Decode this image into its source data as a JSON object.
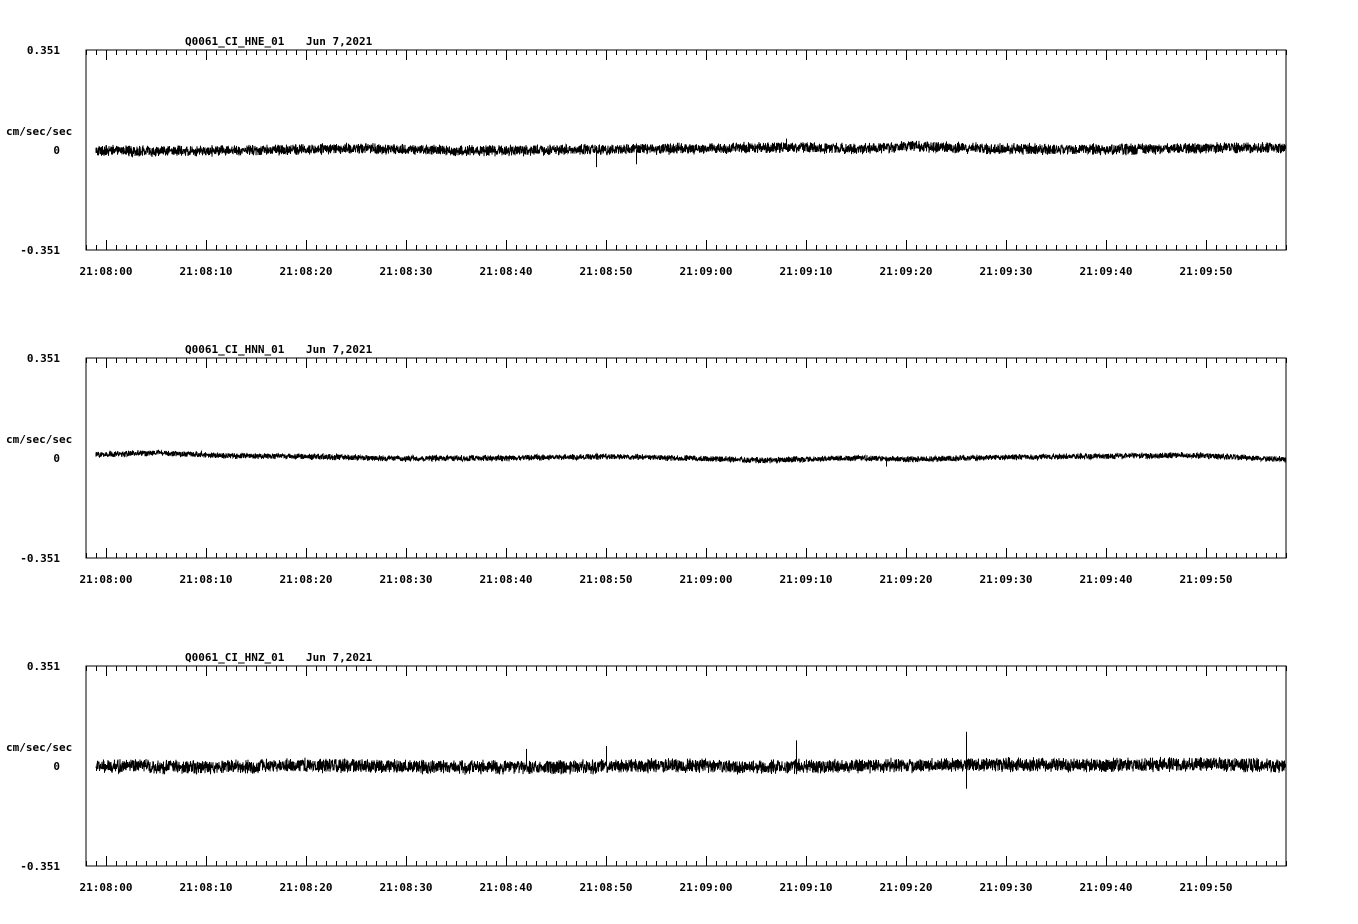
{
  "panels": [
    {
      "title": "Q0061_CI_HNE_01",
      "date": "Jun 7,2021",
      "ylabel": "cm/sec/sec",
      "ytick_labels": [
        "0.351",
        "0",
        "-0.351"
      ],
      "xtick_labels": [
        "21:08:00",
        "21:08:10",
        "21:08:20",
        "21:08:30",
        "21:08:40",
        "21:08:50",
        "21:09:00",
        "21:09:10",
        "21:09:20",
        "21:09:30",
        "21:09:40",
        "21:09:50"
      ]
    },
    {
      "title": "Q0061_CI_HNN_01",
      "date": "Jun 7,2021",
      "ylabel": "cm/sec/sec",
      "ytick_labels": [
        "0.351",
        "0",
        "-0.351"
      ],
      "xtick_labels": [
        "21:08:00",
        "21:08:10",
        "21:08:20",
        "21:08:30",
        "21:08:40",
        "21:08:50",
        "21:09:00",
        "21:09:10",
        "21:09:20",
        "21:09:30",
        "21:09:40",
        "21:09:50"
      ]
    },
    {
      "title": "Q0061_CI_HNZ_01",
      "date": "Jun 7,2021",
      "ylabel": "cm/sec/sec",
      "ytick_labels": [
        "0.351",
        "0",
        "-0.351"
      ],
      "xtick_labels": [
        "21:08:00",
        "21:08:10",
        "21:08:20",
        "21:08:30",
        "21:08:40",
        "21:08:50",
        "21:09:00",
        "21:09:10",
        "21:09:20",
        "21:09:30",
        "21:09:40",
        "21:09:50"
      ]
    }
  ],
  "chart_data": [
    {
      "type": "line",
      "title": "Q0061_CI_HNE_01  Jun 7,2021",
      "ylabel": "cm/sec/sec",
      "ylim": [
        -0.351,
        0.351
      ],
      "x_start": "21:07:58",
      "x_end": "21:09:58",
      "xtick_labels": [
        "21:08:00",
        "21:08:10",
        "21:08:20",
        "21:08:30",
        "21:08:40",
        "21:08:50",
        "21:09:00",
        "21:09:10",
        "21:09:20",
        "21:09:30",
        "21:09:40",
        "21:09:50"
      ],
      "noise_amplitude": 0.022,
      "drift": [
        [
          "21:07:58",
          0.0
        ],
        [
          "21:08:05",
          -0.005
        ],
        [
          "21:08:15",
          0.0
        ],
        [
          "21:08:26",
          0.006
        ],
        [
          "21:08:35",
          -0.003
        ],
        [
          "21:08:45",
          0.0
        ],
        [
          "21:08:50",
          0.002
        ],
        [
          "21:09:00",
          0.005
        ],
        [
          "21:09:08",
          0.01
        ],
        [
          "21:09:15",
          0.004
        ],
        [
          "21:09:20",
          0.012
        ],
        [
          "21:09:30",
          0.004
        ],
        [
          "21:09:40",
          0.002
        ],
        [
          "21:09:50",
          0.006
        ],
        [
          "21:09:58",
          0.008
        ]
      ],
      "spikes": [
        [
          "21:08:49",
          -0.06
        ],
        [
          "21:08:53",
          -0.05
        ],
        [
          "21:09:08",
          0.04
        ]
      ]
    },
    {
      "type": "line",
      "title": "Q0061_CI_HNN_01  Jun 7,2021",
      "ylabel": "cm/sec/sec",
      "ylim": [
        -0.351,
        0.351
      ],
      "x_start": "21:07:58",
      "x_end": "21:09:58",
      "xtick_labels": [
        "21:08:00",
        "21:08:10",
        "21:08:20",
        "21:08:30",
        "21:08:40",
        "21:08:50",
        "21:09:00",
        "21:09:10",
        "21:09:20",
        "21:09:30",
        "21:09:40",
        "21:09:50"
      ],
      "noise_amplitude": 0.012,
      "drift": [
        [
          "21:07:58",
          0.012
        ],
        [
          "21:08:05",
          0.018
        ],
        [
          "21:08:12",
          0.008
        ],
        [
          "21:08:20",
          0.005
        ],
        [
          "21:08:30",
          -0.002
        ],
        [
          "21:08:40",
          0.0
        ],
        [
          "21:08:50",
          0.005
        ],
        [
          "21:09:00",
          -0.002
        ],
        [
          "21:09:05",
          -0.008
        ],
        [
          "21:09:15",
          0.0
        ],
        [
          "21:09:20",
          -0.005
        ],
        [
          "21:09:30",
          0.003
        ],
        [
          "21:09:40",
          0.006
        ],
        [
          "21:09:48",
          0.01
        ],
        [
          "21:09:58",
          -0.005
        ]
      ],
      "spikes": [
        [
          "21:09:18",
          -0.03
        ]
      ]
    },
    {
      "type": "line",
      "title": "Q0061_CI_HNZ_01  Jun 7,2021",
      "ylabel": "cm/sec/sec",
      "ylim": [
        -0.351,
        0.351
      ],
      "x_start": "21:07:58",
      "x_end": "21:09:58",
      "xtick_labels": [
        "21:08:00",
        "21:08:10",
        "21:08:20",
        "21:08:30",
        "21:08:40",
        "21:08:50",
        "21:09:00",
        "21:09:10",
        "21:09:20",
        "21:09:30",
        "21:09:40",
        "21:09:50"
      ],
      "noise_amplitude": 0.028,
      "drift": [
        [
          "21:07:58",
          0.0
        ],
        [
          "21:08:10",
          -0.004
        ],
        [
          "21:08:20",
          0.002
        ],
        [
          "21:08:35",
          -0.003
        ],
        [
          "21:08:45",
          -0.006
        ],
        [
          "21:08:55",
          0.002
        ],
        [
          "21:09:05",
          -0.003
        ],
        [
          "21:09:15",
          -0.001
        ],
        [
          "21:09:25",
          0.005
        ],
        [
          "21:09:40",
          0.003
        ],
        [
          "21:09:50",
          0.006
        ],
        [
          "21:09:58",
          0.0
        ]
      ],
      "spikes": [
        [
          "21:08:42",
          0.06
        ],
        [
          "21:08:50",
          0.07
        ],
        [
          "21:09:09",
          0.09
        ],
        [
          "21:09:26",
          0.12
        ],
        [
          "21:09:26",
          -0.08
        ]
      ]
    }
  ]
}
